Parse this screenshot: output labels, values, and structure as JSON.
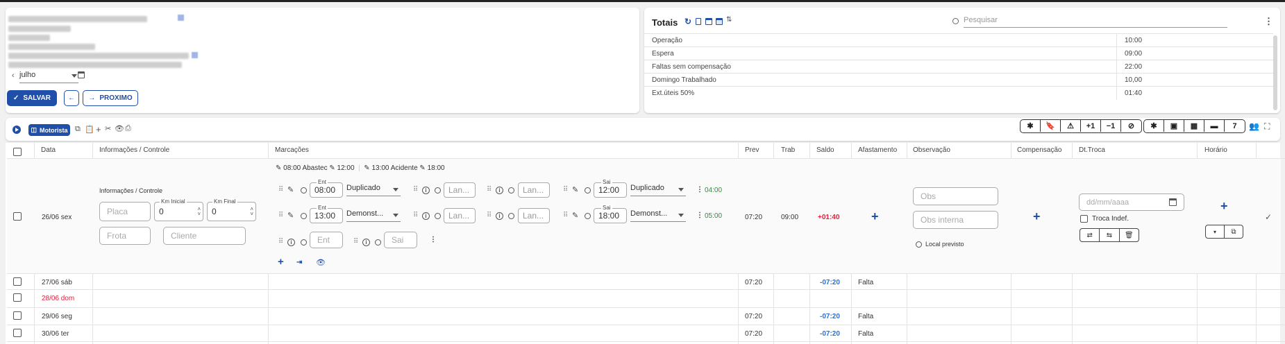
{
  "header": {
    "month_value": "julho",
    "save_label": "SALVAR",
    "next_label": "PROXIMO"
  },
  "totals": {
    "title": "Totais",
    "search_placeholder": "Pesquisar",
    "rows": [
      {
        "label": "Operação",
        "value": "10:00"
      },
      {
        "label": "Espera",
        "value": "09:00"
      },
      {
        "label": "Faltas sem compensação",
        "value": "22:00"
      },
      {
        "label": "Domingo Trabalhado",
        "value": "10,00"
      },
      {
        "label": "Ext.úteis 50%",
        "value": "01:40"
      }
    ]
  },
  "toolbar": {
    "motorista_label": "Motorista",
    "group1": [
      "✱",
      "🔖",
      "⚠",
      "+1",
      "−1",
      "⊘"
    ],
    "group2": [
      "✱",
      "▣",
      "▦",
      "▬",
      "7"
    ]
  },
  "table": {
    "headers": {
      "data": "Data",
      "info": "Informações / Controle",
      "marcacoes": "Marcações",
      "prev": "Prev",
      "trab": "Trab",
      "saldo": "Saldo",
      "afastamento": "Afastamento",
      "observacao": "Observação",
      "compensacao": "Compensação",
      "dttroca": "Dt.Troca",
      "horario": "Horário"
    },
    "first_row": {
      "date": "26/06 sex",
      "info_title": "Informações / Controle",
      "placa_ph": "Placa",
      "km_inicial_label": "Km Inicial",
      "km_inicial_value": "0",
      "km_final_label": "Km Final",
      "km_final_value": "0",
      "frota_ph": "Frota",
      "cliente_ph": "Cliente",
      "summary": {
        "a_time": "08:00",
        "a_text": "Abastec",
        "b_time": "12:00",
        "c_time": "13:00",
        "c_text": "Acidente",
        "d_time": "18:00"
      },
      "line1": {
        "ent_label": "Ent",
        "ent": "08:00",
        "type1": "Duplicado",
        "lan1": "Lan...",
        "lan2": "Lan...",
        "sai_label": "Sai",
        "sai": "12:00",
        "type2": "Duplicado",
        "total": "04:00"
      },
      "line2": {
        "ent_label": "Ent",
        "ent": "13:00",
        "type1": "Demonst...",
        "lan1": "Lan...",
        "lan2": "Lan...",
        "sai_label": "Sai",
        "sai": "18:00",
        "type2": "Demonst...",
        "total": "05:00"
      },
      "ent_ph": "Ent",
      "sai_ph": "Sai",
      "prev": "07:20",
      "trab": "09:00",
      "saldo": "+01:40",
      "obs_ph": "Obs",
      "obs_interna_ph": "Obs interna",
      "local_previsto": "Local previsto",
      "date_ph": "dd/mm/aaaa",
      "troca_indef": "Troca Indef."
    },
    "rows": [
      {
        "date": "27/06 sáb",
        "prev": "07:20",
        "saldo": "-07:20",
        "afast": "Falta",
        "red": false
      },
      {
        "date": "28/06 dom",
        "prev": "",
        "saldo": "",
        "afast": "",
        "red": true
      },
      {
        "date": "29/06 seg",
        "prev": "07:20",
        "saldo": "-07:20",
        "afast": "Falta",
        "red": false
      },
      {
        "date": "30/06 ter",
        "prev": "07:20",
        "saldo": "-07:20",
        "afast": "Falta",
        "red": false
      }
    ]
  },
  "colors": {
    "primary": "#1f4fa8",
    "positive": "#e0233d",
    "negative": "#2a6fd0",
    "green": "#2e8b3a"
  }
}
